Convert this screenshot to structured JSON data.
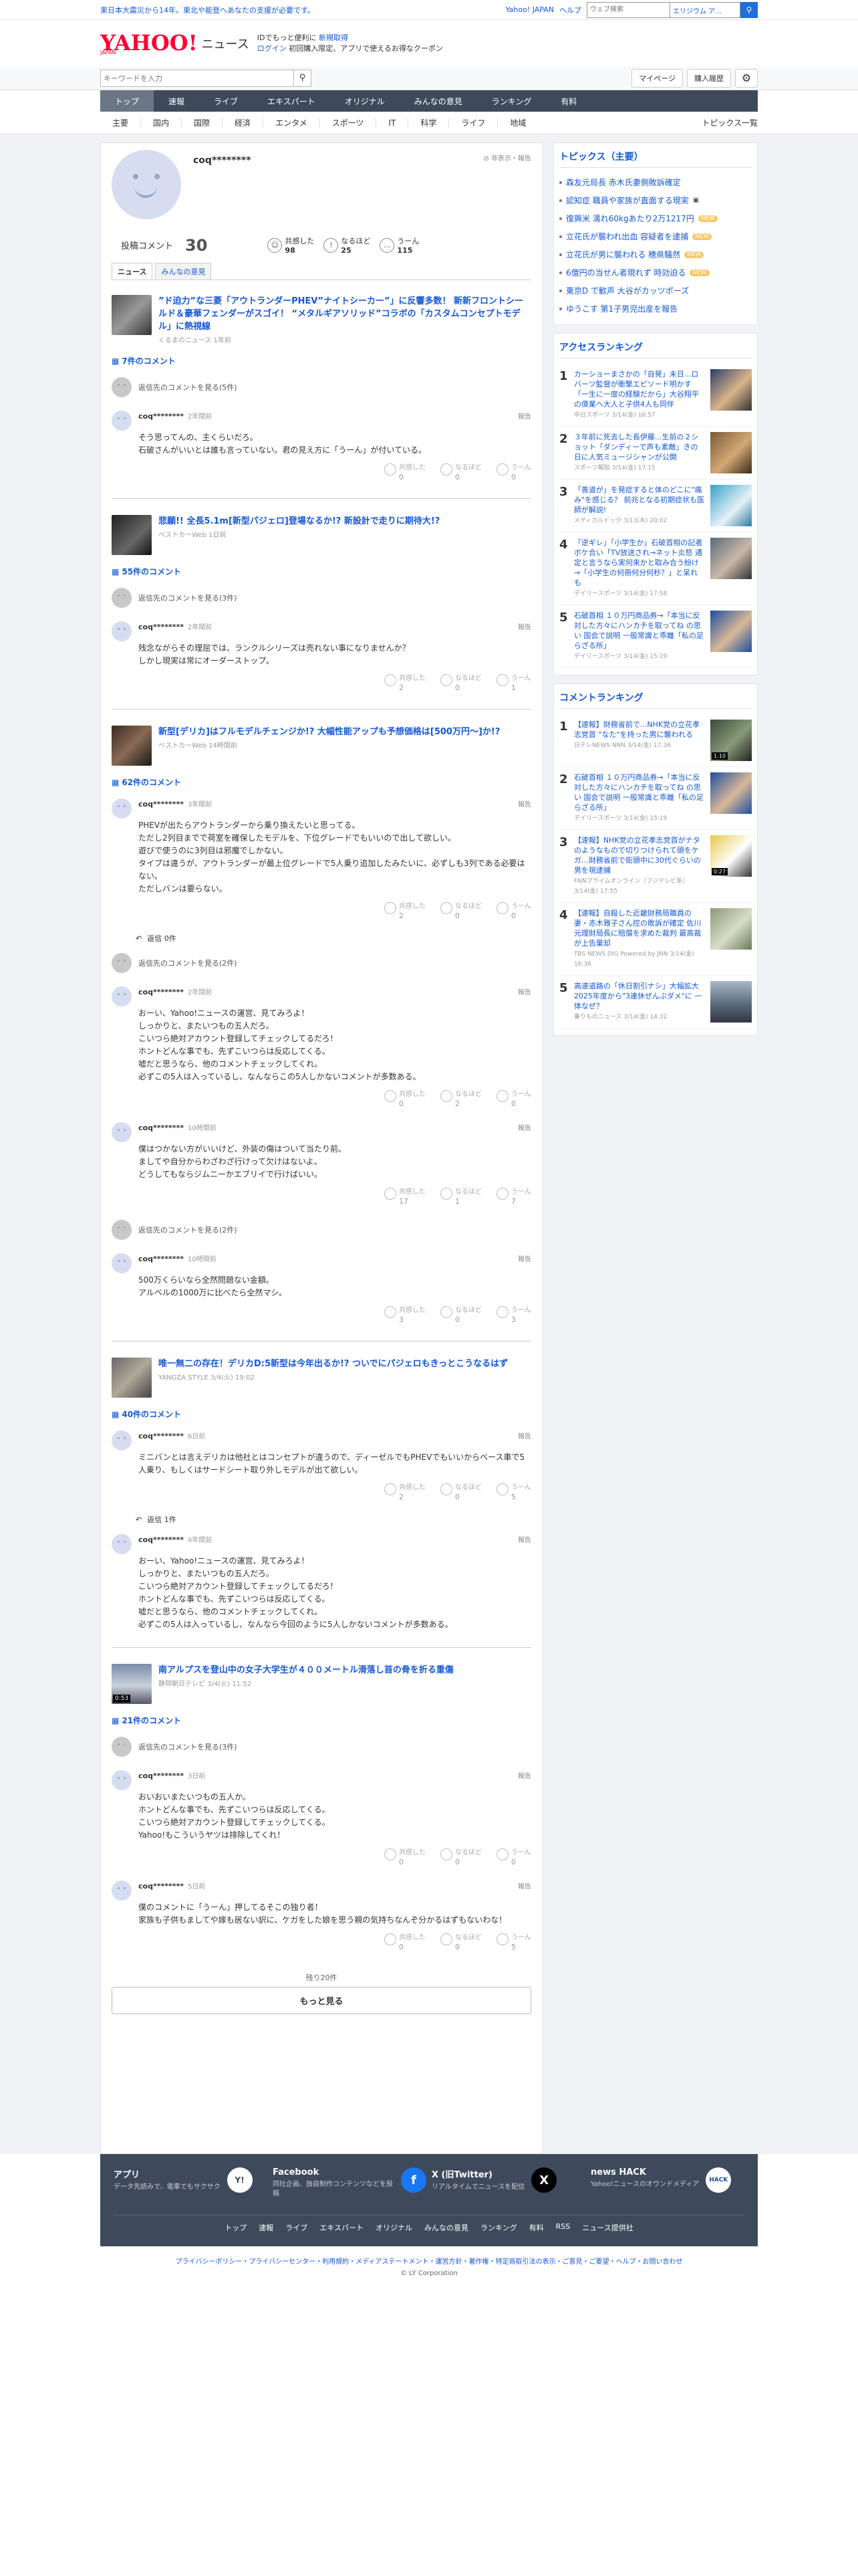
{
  "topbar": {
    "notice": "東日本大震災から14年。東北や能登へあなたの支援が必要です。",
    "links": [
      "Yahoo! JAPAN",
      "ヘルプ"
    ],
    "search_placeholder": "ウェブ検索",
    "search_scope": "エリジウム ア...",
    "search_icon": "search-icon"
  },
  "header": {
    "logo_text": "YAHOO!",
    "logo_sub": "JAPAN",
    "service": "ニュース",
    "msg1_a": "ID",
    "msg1_b": "でもっと便利に",
    "msg1_link": "新規取得",
    "msg2_link": "ログイン",
    "msg2_b": "初回購入限定、アプリで使えるお得なクーポン"
  },
  "keyword": {
    "placeholder": "キーワードを入力",
    "mypage": "マイページ",
    "history": "購入履歴"
  },
  "gnav": [
    "トップ",
    "速報",
    "ライブ",
    "エキスパート",
    "オリジナル",
    "みんなの意見",
    "ランキング",
    "有料"
  ],
  "cnav": [
    "主要",
    "国内",
    "国際",
    "経済",
    "エンタメ",
    "スポーツ",
    "IT",
    "科学",
    "ライフ",
    "地域"
  ],
  "topics_link": "トピックス一覧",
  "profile": {
    "name": "coq********",
    "report": "非表示・報告",
    "posts_label": "投稿コメント",
    "posts": "30",
    "reactions": [
      {
        "label": "共感した",
        "value": "98"
      },
      {
        "label": "なるほど",
        "value": "25"
      },
      {
        "label": "うーん",
        "value": "115"
      }
    ],
    "tabs": [
      "ニュース",
      "みんなの意見"
    ]
  },
  "articles": [
    {
      "title": "”ド迫力”な三菱「アウトランダーPHEV”ナイトシーカー”」に反響多数！ 新新フロントシールド＆豪華フェンダーがスゴイ！ “メタルギアソリッド”コラボの「カスタムコンセプトモデル」に熱視線",
      "source": "くるまのニュース 1年前",
      "count": "7件のコメント",
      "prev": "返信先のコメントを見る(5件)",
      "comments": [
        {
          "user": "coq********",
          "time": "2年間前",
          "text": "そう思ってんの、主くらいだろ。\n石破さんがいいとは誰も言っていない。君の見え方に「うーん」が付いている。",
          "r": [
            "0",
            "0",
            "0"
          ]
        }
      ]
    },
    {
      "title": "悲願!! 全長5.1m[新型パジェロ]登場なるか!? 新設計で走りに期待大!?",
      "source": "ベストカーWeb 1日前",
      "count": "55件のコメント",
      "prev": "返信先のコメントを見る(3件)",
      "comments": [
        {
          "user": "coq********",
          "time": "2年間前",
          "text": "残念ながらその理屈では、ランクルシリーズは売れない事になりませんか？\nしかし現実は常にオーダーストップ。",
          "r": [
            "2",
            "0",
            "1"
          ]
        }
      ]
    },
    {
      "title": "新型[デリカ]はフルモデルチェンジか!? 大幅性能アップも予想価格は[500万円～]か!?",
      "source": "ベストカーWeb 14時間前",
      "count": "62件のコメント",
      "prev": "返信先のコメントを見る(2件)",
      "comments": [
        {
          "user": "coq********",
          "time": "3年間前",
          "text": "PHEVが出たらアウトランダーから乗り換えたいと思ってる。\nただし2列目までで荷室を確保したモデルを、下位グレードでもいいので出して欲しい。\n遊びで使うのに3列目は邪魔でしかない。\nタイプは違うが、アウトランダーが最上位グレードで5人乗り追加したみたいに、必ずしも3列である必要はない。\nただしバンは要らない。",
          "r": [
            "2",
            "0",
            "0"
          ],
          "replies": "返信 0件"
        },
        {
          "user": "coq********",
          "time": "2年間前",
          "text": "おーい、Yahoo!ニュースの運営、見てみろよ！\nしっかりと、またいつもの五人だろ。\nこいつら絶対アカウント登録してチェックしてるだろ！\nホントどんな事でも、先ずこいつらは反応してくる。\n嘘だと思うなら、他のコメントチェックしてくれ。\n必ずこの5人は入っているし、なんならこの5人しかないコメントが多数ある。",
          "r": [
            "0",
            "2",
            "0"
          ]
        },
        {
          "user": "coq********",
          "time": "10時間前",
          "text": "僕はつかない方がいいけど、外装の傷はついて当たり前。\nましてや自分からわざわざ行けって欠けはないよ。\nどうしてもならジムニーかエブリイで行けばいい。",
          "r": [
            "17",
            "1",
            "7"
          ]
        }
      ],
      "prev2": "返信先のコメントを見る(2件)",
      "extra": {
        "user": "coq********",
        "time": "10時間前",
        "text": "500万くらいなら全然問題ない金額。\nアルベルの1000万に比べたら全然マシ。",
        "r": [
          "3",
          "0",
          "3"
        ]
      }
    },
    {
      "title": "唯一無二の存在！デリカD:5新型は今年出るか!? ついでにパジェロもきっとこうなるはず",
      "source": "YANGZA STYLE 3/4(火) 19:02",
      "count": "40件のコメント",
      "comments": [
        {
          "user": "coq********",
          "time": "6日前",
          "text": "ミニバンとは言えデリカは他社とはコンセプトが違うので、ディーゼルでもPHEVでもいいからベース車で5人乗り、もしくはサードシート取り外しモデルが出て欲しい。",
          "r": [
            "2",
            "0",
            "5"
          ],
          "replies": "返信 1件"
        },
        {
          "user": "coq********",
          "time": "4年間前",
          "text": "おーい、Yahoo!ニュースの運営、見てみろよ！\nしっかりと、またいつもの五人だろ。\nこいつら絶対アカウント登録してチェックしてるだろ！\nホントどんな事でも、先ずこいつらは反応してくる。\n嘘だと思うなら、他のコメントチェックしてくれ。\n必ずこの5人は入っているし、なんなら今回のように5人しかないコメントが多数ある。",
          "r": [],
          "no_react": true
        }
      ]
    },
    {
      "title": "南アルプスを登山中の女子大学生が４００メートル滑落し首の骨を折る重傷",
      "source": "静岡朝日テレビ 3/4(火) 11:52",
      "video": "0:53",
      "count": "21件のコメント",
      "prev": "返信先のコメントを見る(3件)",
      "comments": [
        {
          "user": "coq********",
          "time": "3日前",
          "text": "おいおいまたいつもの五人か。\nホントどんな事でも、先ずこいつらは反応してくる。\nこいつら絶対アカウント登録してチェックしてくる。\nYahoo!もこういうヤツは排除してくれ！",
          "r": [
            "0",
            "0",
            "0"
          ]
        },
        {
          "user": "coq********",
          "time": "5日前",
          "text": "僕のコメントに「うーん」押してるそこの独り者！\n家族も子供もましてや嫁も居ない訳に、ケガをした娘を思う親の気持ちなんぞ分かるはずもないわな！",
          "r": [
            "0",
            "0",
            "5"
          ]
        }
      ]
    }
  ],
  "react_labels": [
    "共感した",
    "なるほど",
    "うーん"
  ],
  "report_label": "報告",
  "more": {
    "remaining": "残り20件",
    "button": "もっと見る"
  },
  "side": {
    "topics_title": "トピックス（主要）",
    "topics": [
      {
        "t": "森友元局長 赤木氏妻側敗訴確定"
      },
      {
        "t": "認知症 職員や家族が直面する現実",
        "tag": ""
      },
      {
        "t": "復興米 濡れ60kgあたり2万1217円",
        "tag": "NEW"
      },
      {
        "t": "立花氏が襲われ出血 容疑者を逮捕",
        "tag": "NEW"
      },
      {
        "t": "立花氏が男に襲われる 穂県騒然",
        "tag": "NEW"
      },
      {
        "t": "6億円の当せん者現れず 時効迫る",
        "tag": "NEW"
      },
      {
        "t": "東京D で歓声 大谷がカッツポーズ"
      },
      {
        "t": "ゆうこす 第1子男児出産を報告"
      }
    ],
    "access_title": "アクセスランキング",
    "access": [
      {
        "n": "1",
        "t": "カーショーまさかの「自発」未日...ロバーツ監督が衝撃エピソード明かす「一生に一度の経験だから」大谷翔平の偉業へ大人と子供4人も同伴",
        "s": "中日スポーツ 3/14(金) 16:57"
      },
      {
        "n": "2",
        "t": "３年前に死去した長伊藤...生前の２ショット「ダンディーで声も素敵」きの日に人気ミュージシャンが公開",
        "s": "スポーツ報知 3/14(金) 17:15"
      },
      {
        "n": "3",
        "t": "「善道が」を発症すると体のどこに\"痛み\"を感じる？ 前兆となる初期症状も医師が解説!",
        "s": "メディカルドック 3/13(木) 20:02"
      },
      {
        "n": "4",
        "t": "「逆ギレ」「小学生か」石破首相の記者ボケ合い「TV放送され→ネット炎怒 通定と言うなら実何来かと取み合う紛け→「小学生の何冊何分何秒？」と呆れも",
        "s": "デイリースポーツ 3/14(金) 17:58"
      },
      {
        "n": "5",
        "t": "石破首相 １０万円商品券→「本当に反対した方々にハンカチを取ってね の思い 国会で説明 一般常識と乖離「私の足らざる所」",
        "s": "デイリースポーツ 3/14(金) 15:19"
      }
    ],
    "comment_title": "コメントランキング",
    "comments": [
      {
        "n": "1",
        "t": "【速報】財務省前で...NHK党の立花孝志党首 \"なた\"を持った男に襲われる",
        "s": "日テレNEWS NNN 3/14(金) 17:36",
        "v": "1:10"
      },
      {
        "n": "2",
        "t": "石破首相 １０万円商品券→「本当に反対した方々にハンカチを取ってね の思い 国会で説明 一般常識と乖離「私の足らざる所」",
        "s": "デイリースポーツ 3/14(金) 15:19"
      },
      {
        "n": "3",
        "t": "【速報】NHK党の立花孝志党首がナタのようなもので切りつけられて頭をケガ…財務省前で街頭中に30代ぐらいの男を現逮捕",
        "s": "FNNプライムオンライン（フジテレビ系） 3/14(金) 17:55",
        "v": "0:27"
      },
      {
        "n": "4",
        "t": "【速報】自殺した近畿財務局職員の妻・赤木雅子さん控の敗訴が確定 佐川元理財局長に賠償を求めた裁判 最高裁が上告棄却",
        "s": "TBS NEWS DIG Powered by JNN 3/14(金) 16:36"
      },
      {
        "n": "5",
        "t": "高速道路の「休日割引ナシ」大幅拡大 2025年度から\"3連休ぜんぶダメ\"に 一体なぜ？",
        "s": "乗りものニュース 3/14(金) 14:32"
      }
    ]
  },
  "footer": {
    "blocks": [
      {
        "t": "アプリ",
        "d": "データ先読みで、電車でもサクサク",
        "ic": "Y!"
      },
      {
        "t": "Facebook",
        "d": "同社企画、独自制作コンテンツなどを投稿",
        "ic": "f"
      },
      {
        "t": "X (旧Twitter)",
        "d": "リアルタイムでニュースを配信",
        "ic": "X"
      },
      {
        "t": "news HACK",
        "d": "Yahoo!ニュースのオウンドメディア",
        "ic": "HACK"
      }
    ],
    "links": [
      "トップ",
      "速報",
      "ライブ",
      "エキスパート",
      "オリジナル",
      "みんなの意見",
      "ランキング",
      "有料",
      "RSS",
      "ニュース提供社"
    ],
    "legal": "プライバシーポリシー・プライバシーセンター・利用規約・メディアステートメント・運営方針・著作権・特定商取引法の表示・ご意見・ご要望・ヘルプ・お問い合わせ",
    "copy": "© LY Corporation"
  }
}
